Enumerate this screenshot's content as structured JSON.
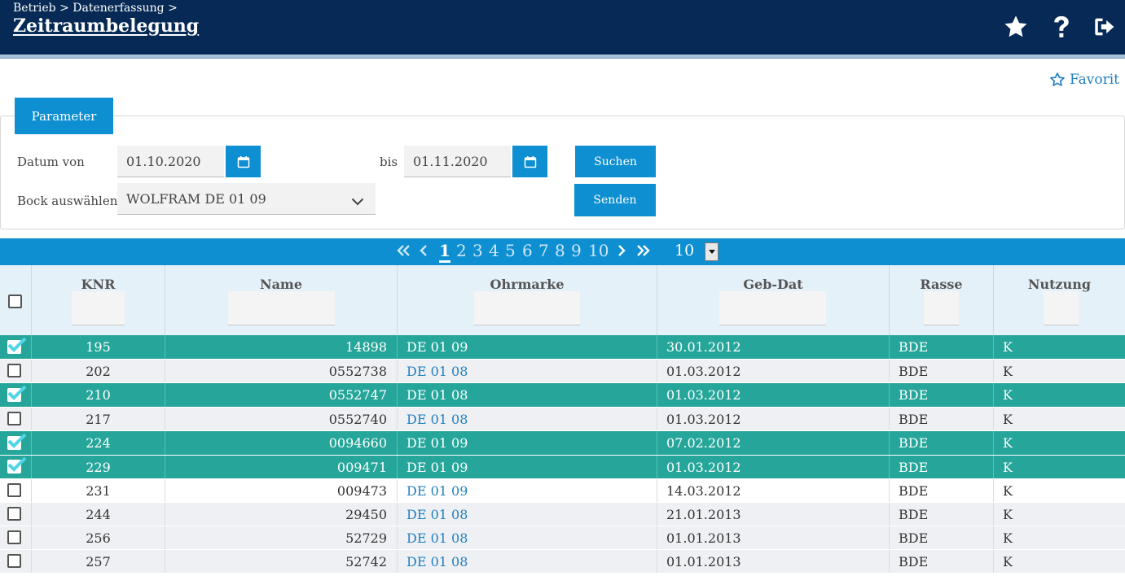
{
  "header": {
    "breadcrumb": "Betrieb > Datenerfassung >",
    "title": "Zeitraumbelegung",
    "icons": [
      "star-icon",
      "question-icon",
      "logout-icon"
    ],
    "bg_color": "#062a55"
  },
  "favorit_label": "Favorit",
  "parameter": {
    "tab_label": "Parameter",
    "datum_von_label": "Datum von",
    "datum_von_value": "01.10.2020",
    "bis_label": "bis",
    "bis_value": "01.11.2020",
    "bock_label": "Bock auswählen",
    "bock_value": "WOLFRAM DE 01 09",
    "suchen_label": "Suchen",
    "senden_label": "Senden"
  },
  "pager": {
    "pages": [
      "1",
      "2",
      "3",
      "4",
      "5",
      "6",
      "7",
      "8",
      "9",
      "10"
    ],
    "active_page": "1",
    "page_size": "10"
  },
  "table": {
    "columns": [
      "KNR",
      "Name",
      "Ohrmarke",
      "Geb-Dat",
      "Rasse",
      "Nutzung"
    ],
    "rows": [
      {
        "selected": true,
        "knr": "195",
        "name": "14898",
        "ohrmarke": "DE 01 09",
        "gebdat": "30.01.2012",
        "rasse": "BDE",
        "nutzung": "K"
      },
      {
        "selected": false,
        "knr": "202",
        "name": "0552738",
        "ohrmarke": "DE 01 08",
        "gebdat": "01.03.2012",
        "rasse": "BDE",
        "nutzung": "K"
      },
      {
        "selected": true,
        "knr": "210",
        "name": "0552747",
        "ohrmarke": "DE 01 08",
        "gebdat": "01.03.2012",
        "rasse": "BDE",
        "nutzung": "K"
      },
      {
        "selected": false,
        "knr": "217",
        "name": "0552740",
        "ohrmarke": "DE 01 08",
        "gebdat": "01.03.2012",
        "rasse": "BDE",
        "nutzung": "K"
      },
      {
        "selected": true,
        "knr": "224",
        "name": "0094660",
        "ohrmarke": "DE 01 09",
        "gebdat": "07.02.2012",
        "rasse": "BDE",
        "nutzung": "K"
      },
      {
        "selected": true,
        "knr": "229",
        "name": "009471",
        "ohrmarke": "DE 01 09",
        "gebdat": "01.03.2012",
        "rasse": "BDE",
        "nutzung": "K"
      },
      {
        "selected": false,
        "knr": "231",
        "name": "009473",
        "ohrmarke": "DE 01 09",
        "gebdat": "14.03.2012",
        "rasse": "BDE",
        "nutzung": "K"
      },
      {
        "selected": false,
        "knr": "244",
        "name": "29450",
        "ohrmarke": "DE 01 08",
        "gebdat": "21.01.2013",
        "rasse": "BDE",
        "nutzung": "K"
      },
      {
        "selected": false,
        "knr": "256",
        "name": "52729",
        "ohrmarke": "DE 01 08",
        "gebdat": "01.01.2013",
        "rasse": "BDE",
        "nutzung": "K"
      },
      {
        "selected": false,
        "knr": "257",
        "name": "52742",
        "ohrmarke": "DE 01 08",
        "gebdat": "01.01.2013",
        "rasse": "BDE",
        "nutzung": "K"
      }
    ]
  },
  "colors": {
    "accent": "#0d8fd1",
    "selected_row": "#26a69a",
    "link": "#1f7fc0"
  }
}
